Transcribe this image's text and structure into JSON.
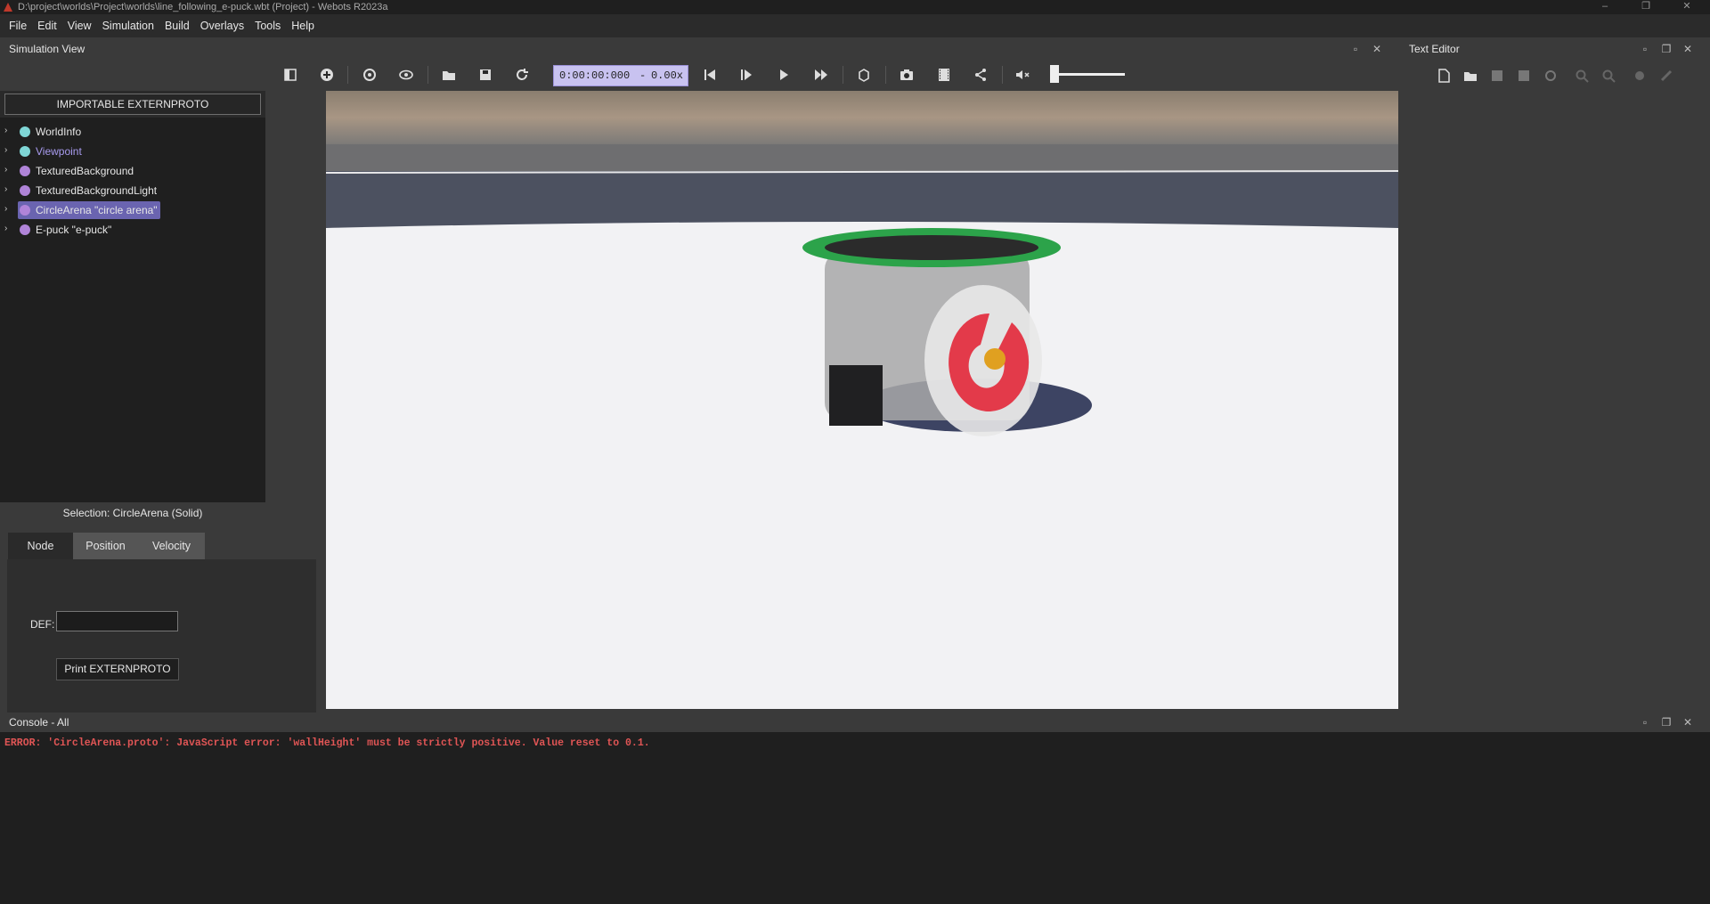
{
  "window": {
    "title": "D:\\project\\worlds\\Project\\worlds\\line_following_e-puck.wbt (Project) - Webots R2023a",
    "controls": [
      "–",
      "❐",
      "✕"
    ]
  },
  "menubar": {
    "items": [
      "File",
      "Edit",
      "View",
      "Simulation",
      "Build",
      "Overlays",
      "Tools",
      "Help"
    ]
  },
  "simulation_view": {
    "title": "Simulation View",
    "time": "0:00:00:000",
    "separator": "-",
    "speed": "0.00x",
    "volume_level": 0.0
  },
  "scene_tree": {
    "importable_button": "IMPORTABLE EXTERNPROTO",
    "items": [
      {
        "label": "WorldInfo",
        "color": "#7fd6d6"
      },
      {
        "label": "Viewpoint",
        "color": "#7fd6d6"
      },
      {
        "label": "TexturedBackground",
        "color": "#b084d8"
      },
      {
        "label": "TexturedBackgroundLight",
        "color": "#b084d8"
      },
      {
        "label": "CircleArena \"circle arena\"",
        "color": "#b084d8"
      },
      {
        "label": "E-puck \"e-puck\"",
        "color": "#b084d8"
      }
    ],
    "viewpoint_color": "#a99cf0",
    "selected_index": 4
  },
  "selection": {
    "label": "Selection: CircleArena (Solid)",
    "tabs": [
      "Node",
      "Position",
      "Velocity"
    ],
    "active_tab": 0,
    "def_label": "DEF:",
    "def_value": "",
    "print_button": "Print EXTERNPROTO"
  },
  "text_editor": {
    "title": "Text Editor"
  },
  "console": {
    "title": "Console - All",
    "messages": [
      "ERROR: 'CircleArena.proto': JavaScript error: 'wallHeight' must be strictly positive. Value reset to 0.1."
    ]
  },
  "colors": {
    "error": "#e05555",
    "time_box": "#c8c2f0",
    "selected_highlight": "#6a64b0"
  }
}
